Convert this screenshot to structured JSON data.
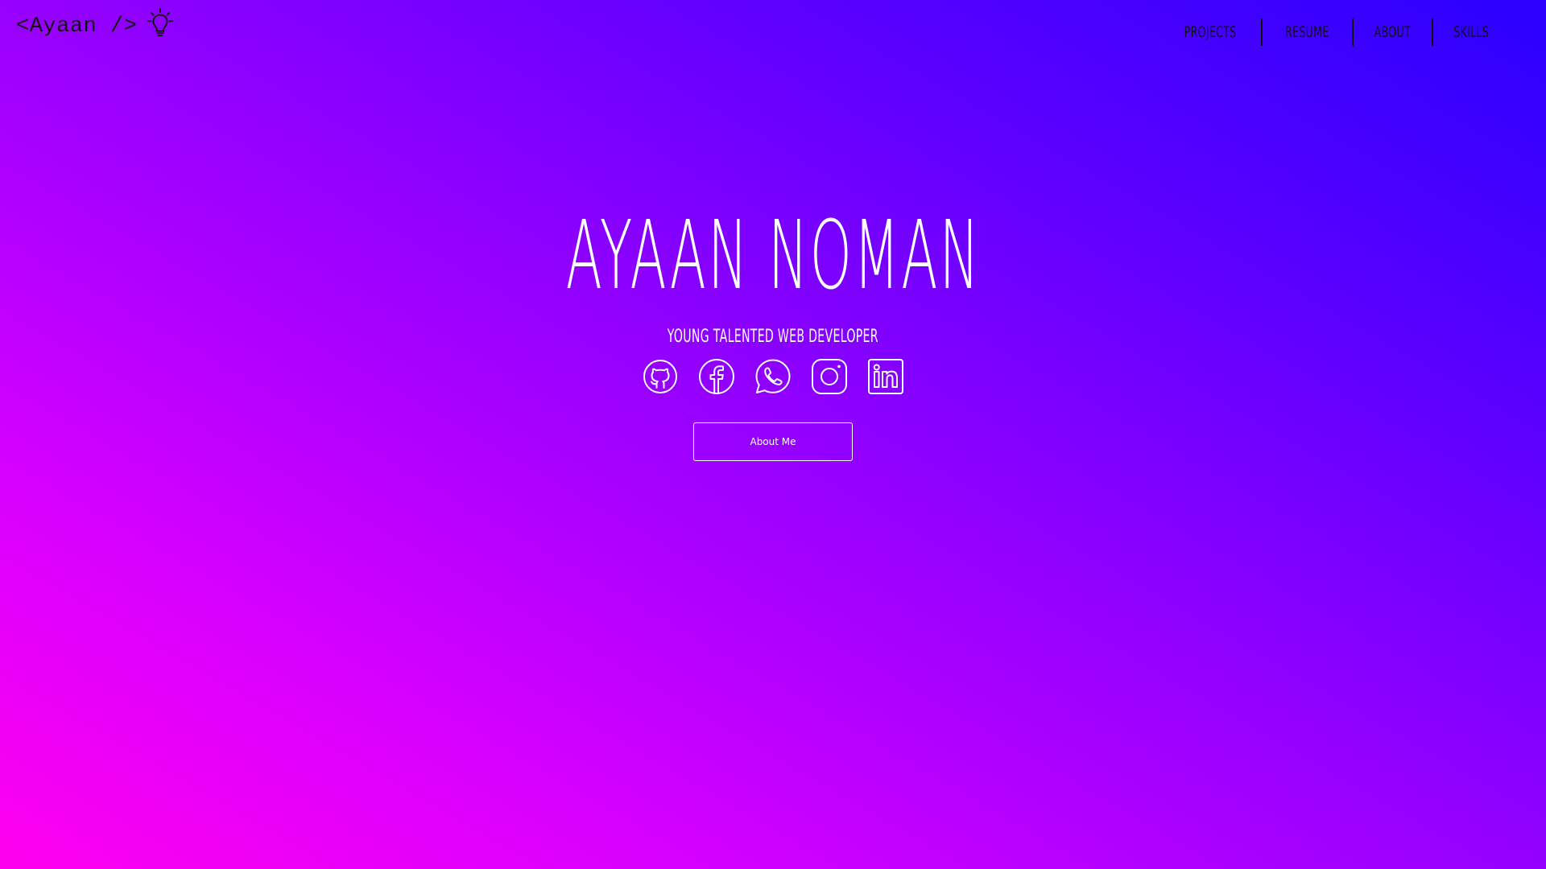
{
  "header": {
    "logo_text": "<Ayaan />",
    "logo_icon": "lightbulb-icon",
    "nav": [
      {
        "label": "Projects"
      },
      {
        "label": "Resume"
      },
      {
        "label": "About"
      },
      {
        "label": "Skills"
      }
    ]
  },
  "hero": {
    "name": "AYAAN NOMAN",
    "subtitle": "YOUNG TALENTED WEB DEVELOPER",
    "socials": [
      {
        "icon": "github-icon"
      },
      {
        "icon": "facebook-icon"
      },
      {
        "icon": "whatsapp-icon"
      },
      {
        "icon": "instagram-icon"
      },
      {
        "icon": "linkedin-icon"
      }
    ],
    "button_label": "About Me"
  },
  "colors": {
    "gradient_start": "#ff00ee",
    "gradient_end": "#2a00ff",
    "text": "#ffffff",
    "nav_text": "#111111"
  }
}
